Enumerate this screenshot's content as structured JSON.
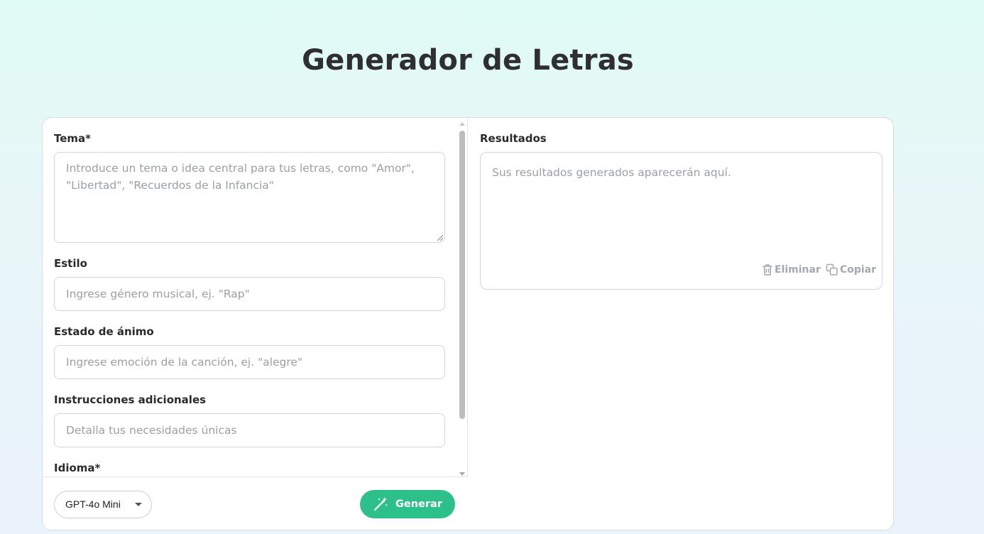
{
  "page": {
    "title": "Generador de Letras"
  },
  "form": {
    "tema": {
      "label": "Tema*",
      "placeholder_line1": "Introduce un tema o idea central para tus letras, como \"Amor\",",
      "placeholder_line2": "\"Libertad\", \"Recuerdos de la Infancia\""
    },
    "estilo": {
      "label": "Estilo",
      "placeholder": "Ingrese género musical, ej. \"Rap\""
    },
    "estado_animo": {
      "label": "Estado de ánimo",
      "placeholder": "Ingrese emoción de la canción, ej. \"alegre\""
    },
    "instrucciones": {
      "label": "Instrucciones adicionales",
      "placeholder": "Detalla tus necesidades únicas"
    },
    "idioma": {
      "label": "Idioma*"
    }
  },
  "footer": {
    "model_value": "GPT-4o Mini",
    "generate_label": "Generar"
  },
  "results": {
    "label": "Resultados",
    "placeholder": "Sus resultados generados aparecerán aquí.",
    "delete_label": "Eliminar",
    "copy_label": "Copiar"
  },
  "colors": {
    "accent": "#2ec08b",
    "muted_text": "#9aa0a6",
    "border": "#cfd6dc"
  }
}
